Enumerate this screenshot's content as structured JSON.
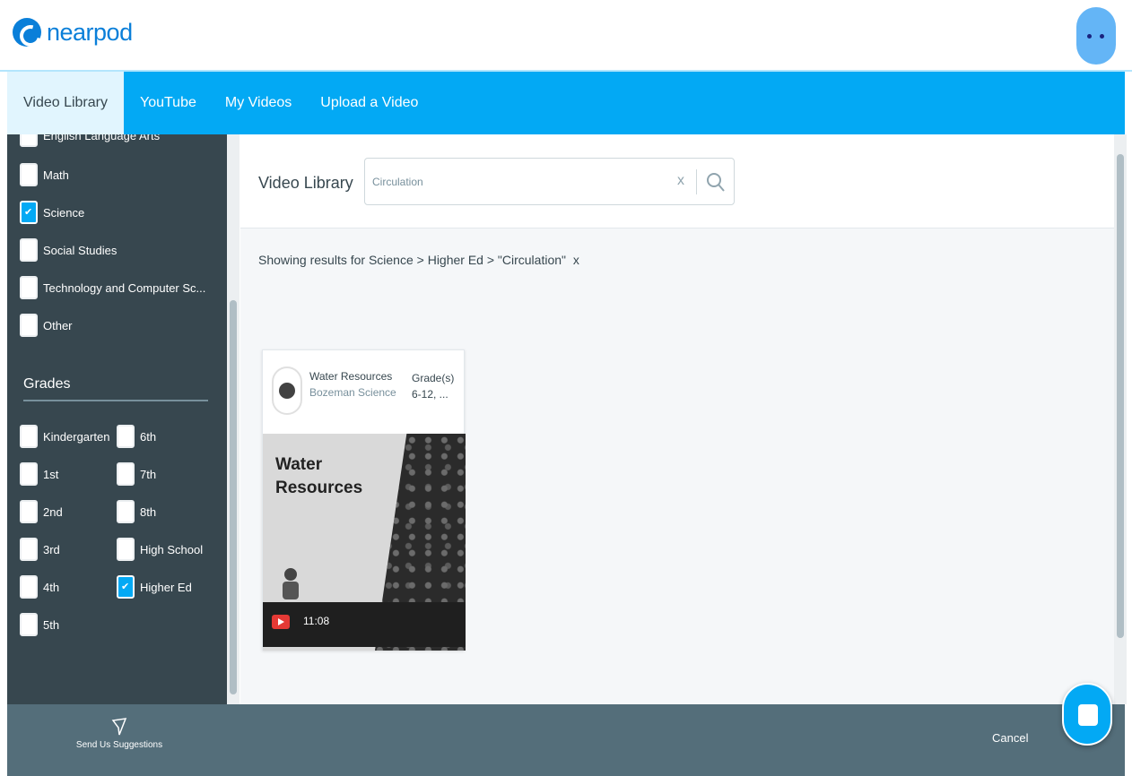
{
  "header": {
    "logo_text": "nearpod"
  },
  "tabs": [
    {
      "label": "Video Library",
      "active": true
    },
    {
      "label": "YouTube",
      "active": false
    },
    {
      "label": "My Videos",
      "active": false
    },
    {
      "label": "Upload a Video",
      "active": false
    }
  ],
  "subjects": [
    {
      "label": "English Language Arts",
      "checked": false
    },
    {
      "label": "Math",
      "checked": false
    },
    {
      "label": "Science",
      "checked": true
    },
    {
      "label": "Social Studies",
      "checked": false
    },
    {
      "label": "Technology and Computer Sc...",
      "checked": false
    },
    {
      "label": "Other",
      "checked": false
    }
  ],
  "grades": {
    "heading": "Grades",
    "items": [
      {
        "label": "Kindergarten",
        "checked": false
      },
      {
        "label": "1st",
        "checked": false
      },
      {
        "label": "2nd",
        "checked": false
      },
      {
        "label": "3rd",
        "checked": false
      },
      {
        "label": "4th",
        "checked": false
      },
      {
        "label": "5th",
        "checked": false
      },
      {
        "label": "6th",
        "checked": false
      },
      {
        "label": "7th",
        "checked": false
      },
      {
        "label": "8th",
        "checked": false
      },
      {
        "label": "High School",
        "checked": false
      },
      {
        "label": "Higher Ed",
        "checked": true
      }
    ]
  },
  "search": {
    "label": "Video Library",
    "value": "Circulation",
    "clear": "x"
  },
  "results": {
    "text": "Showing results for Science > Higher Ed > \"Circulation\"",
    "clear": "x"
  },
  "video": {
    "title": "Water Resources",
    "channel": "Bozeman Science",
    "grades_label": "Grade(s)",
    "grades_value": "6-12, ...",
    "thumbnail_title": "Water Resources",
    "duration": "11:08"
  },
  "footer": {
    "suggest_label": "Send Us Suggestions",
    "cancel_label": "Cancel"
  },
  "colors": {
    "accent": "#03a9f4",
    "sidebar": "#37474f",
    "footer": "#546e7a",
    "logo": "#0a7fd9"
  },
  "icons": {
    "search": "search-icon",
    "send": "send-icon",
    "youtube": "youtube-play-icon",
    "chat": "chat-icon"
  }
}
